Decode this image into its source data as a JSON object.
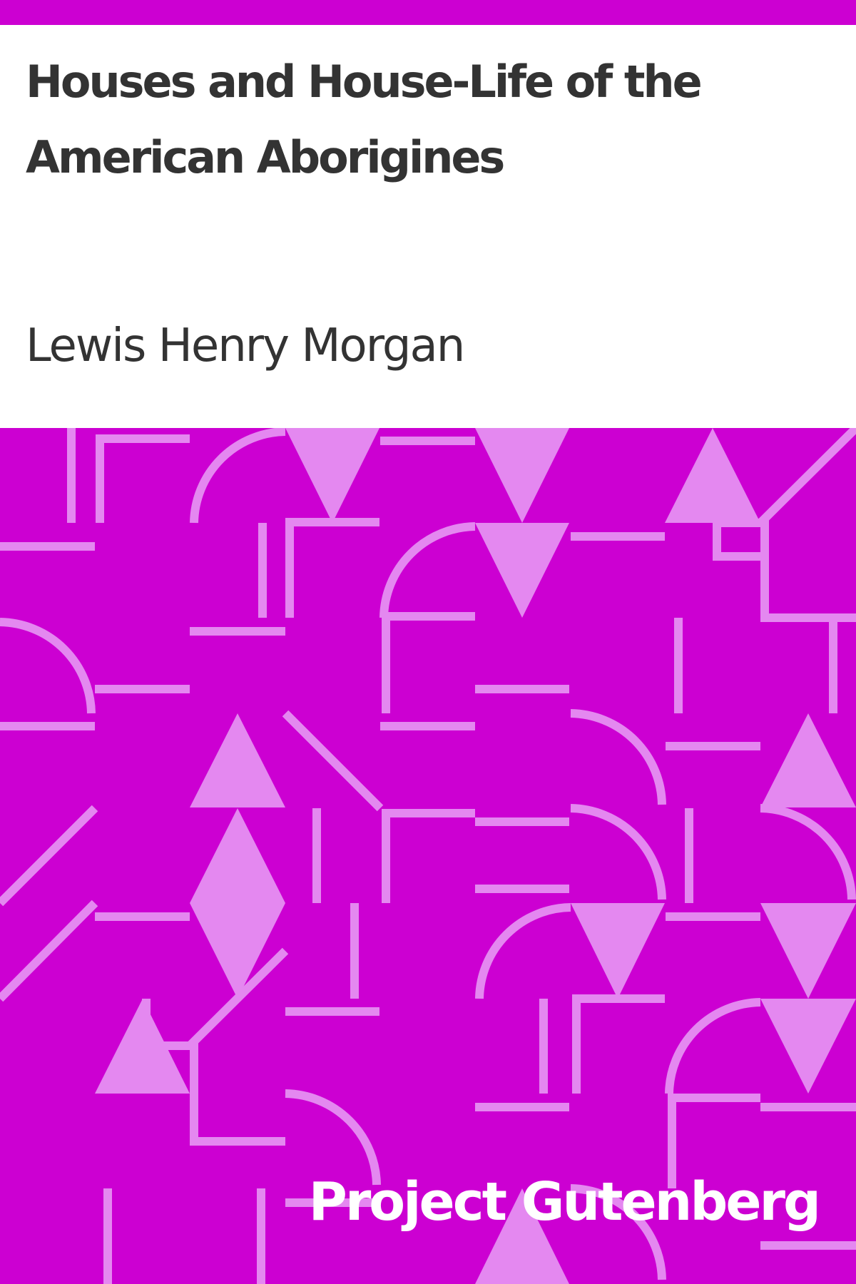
{
  "cover": {
    "title": "Houses and House-Life of the American Aborigines",
    "author": "Lewis Henry Morgan",
    "publisher": "Project Gutenberg"
  },
  "colors": {
    "background": "#cc00d2",
    "pattern": "#e488f0",
    "title_area": "#ffffff",
    "text": "#333333",
    "publisher_text": "#ffffff"
  }
}
